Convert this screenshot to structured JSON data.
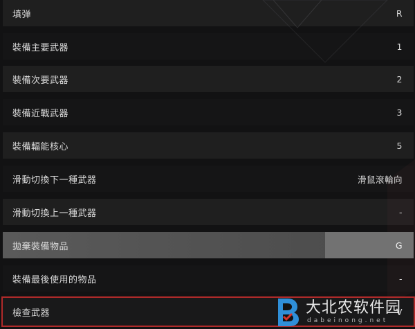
{
  "keybinds": [
    {
      "label": "填弹",
      "key": "R"
    },
    {
      "label": "裝備主要武器",
      "key": "1"
    },
    {
      "label": "裝備次要武器",
      "key": "2"
    },
    {
      "label": "裝備近戰武器",
      "key": "3"
    },
    {
      "label": "裝備輻能核心",
      "key": "5"
    },
    {
      "label": "滑動切換下一種武器",
      "key": "滑鼠滾輪向"
    },
    {
      "label": "滑動切換上一種武器",
      "key": "-"
    },
    {
      "label": "拋棄裝備物品",
      "key": "G"
    },
    {
      "label": "裝備最後使用的物品",
      "key": "-"
    },
    {
      "label": "檢查武器",
      "key": "V"
    }
  ],
  "selected_index": 7,
  "highlighted_index": 9,
  "watermark": {
    "main": "大北农软件园",
    "sub": "dabeinong.net"
  },
  "colors": {
    "highlight_border": "#b02a2a",
    "logo_blue": "#2f8fd8",
    "logo_red": "#d8342c"
  }
}
